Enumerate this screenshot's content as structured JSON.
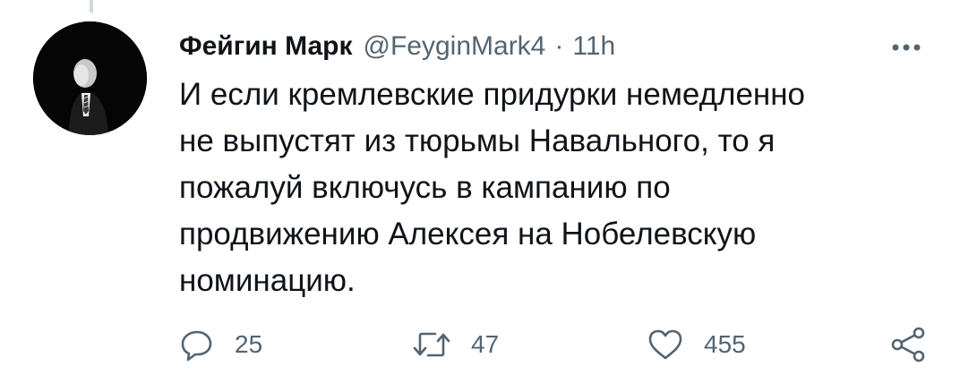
{
  "tweet": {
    "author_name": "Фейгин Марк",
    "author_handle": "@FeyginMark4",
    "separator": "·",
    "time": "11h",
    "text_lines": [
      "И если кремлевские придурки немедленно",
      "не выпустят из тюрьмы Навального, то я",
      "пожалуй включусь в кампанию по",
      "продвижению Алексея на Нобелевскую",
      "номинацию."
    ]
  },
  "actions": {
    "reply_count": "25",
    "retweet_count": "47",
    "like_count": "455"
  },
  "icons": {
    "avatar": "avatar-photo",
    "more": "more-icon",
    "reply": "reply-icon",
    "retweet": "retweet-icon",
    "like": "heart-icon",
    "share": "share-icon"
  },
  "colors": {
    "text_primary": "#0f1419",
    "text_secondary": "#536471",
    "thread_line": "#cfd9de"
  }
}
